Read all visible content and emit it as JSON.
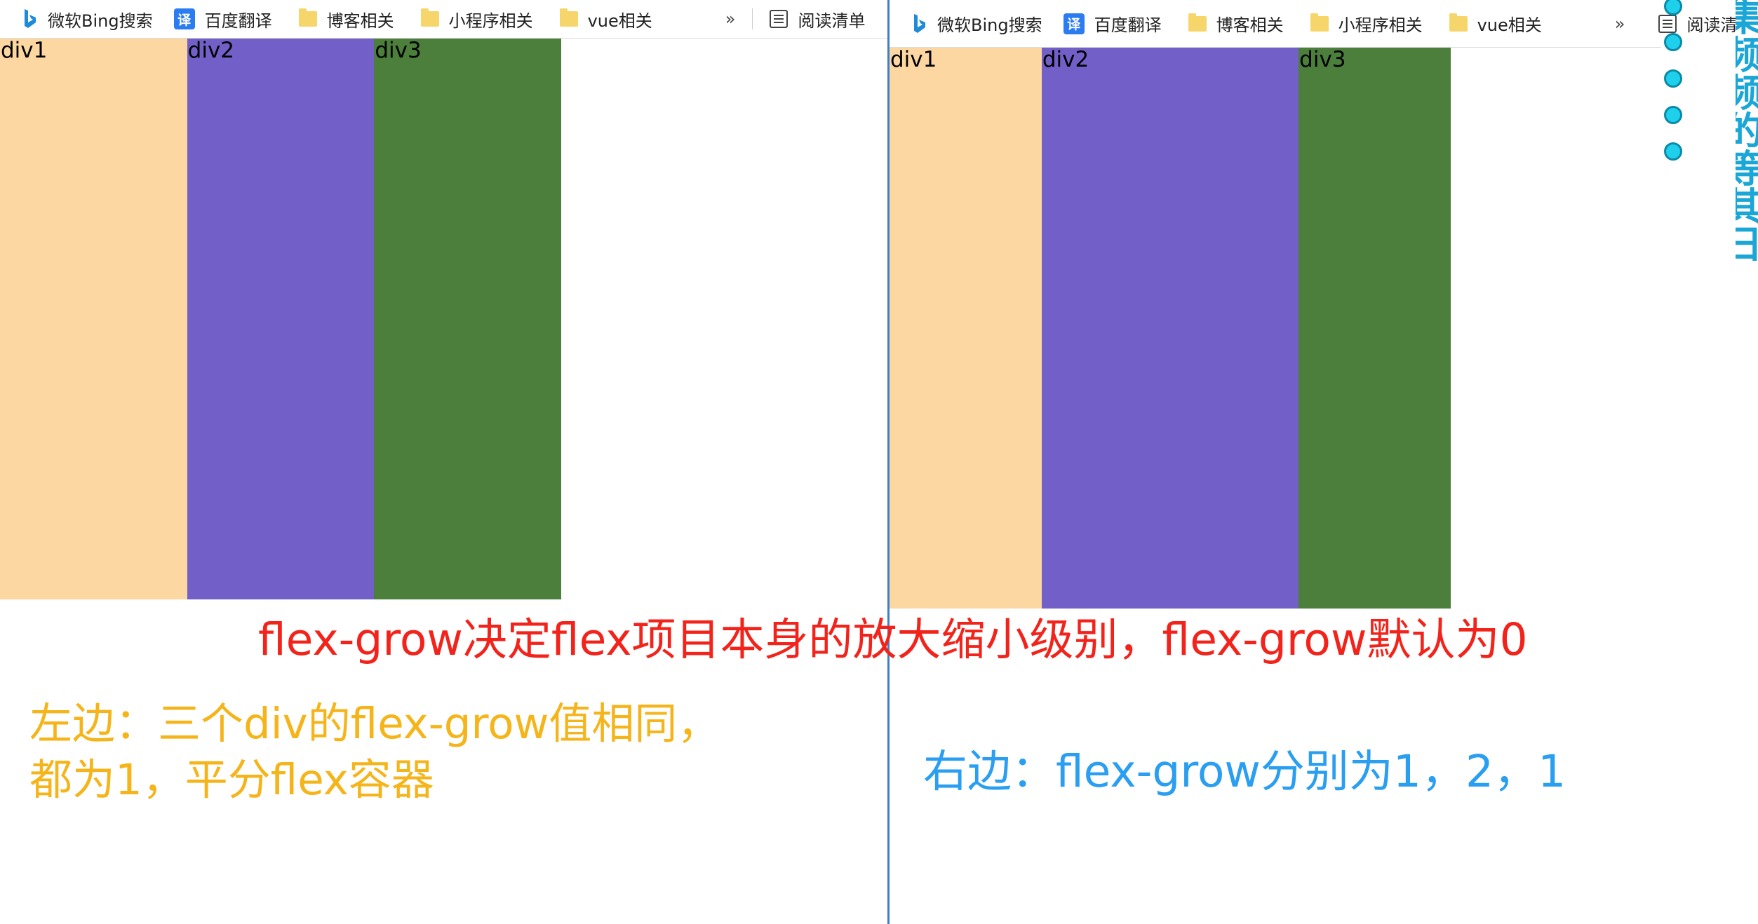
{
  "bookmarks": {
    "items": [
      {
        "label": "微软Bing搜索",
        "icon": "bing-icon"
      },
      {
        "label": "百度翻译",
        "icon": "translate-icon"
      },
      {
        "label": "博客相关",
        "icon": "folder-icon"
      },
      {
        "label": "小程序相关",
        "icon": "folder-icon"
      },
      {
        "label": "vue相关",
        "icon": "folder-icon"
      }
    ],
    "more": "»",
    "reading_list": "阅读清单",
    "reading_list_right": "阅读清"
  },
  "left_demo": {
    "items": [
      {
        "label": "div1",
        "color": "#fdd7a2",
        "flex_grow": 1
      },
      {
        "label": "div2",
        "color": "#7260c8",
        "flex_grow": 1
      },
      {
        "label": "div3",
        "color": "#4b7f3b",
        "flex_grow": 1
      }
    ]
  },
  "right_demo": {
    "items": [
      {
        "label": "div1",
        "color": "#fdd7a2",
        "flex_grow": 1
      },
      {
        "label": "div2",
        "color": "#7260c8",
        "flex_grow": 2
      },
      {
        "label": "div3",
        "color": "#4b7f3b",
        "flex_grow": 1
      }
    ]
  },
  "captions": {
    "main": "flex-grow决定flex项目本身的放大缩小级别，flex-grow默认为0",
    "main_color": "#f2231b",
    "left_line1": "左边：三个div的flex-grow值相同，",
    "left_line2": "都为1，平分flex容器",
    "left_color": "#f5b51a",
    "right": "右边：flex-grow分别为1，2，1",
    "right_color": "#2a9ef0"
  },
  "side_panel": {
    "text": "集频频的等其日"
  }
}
